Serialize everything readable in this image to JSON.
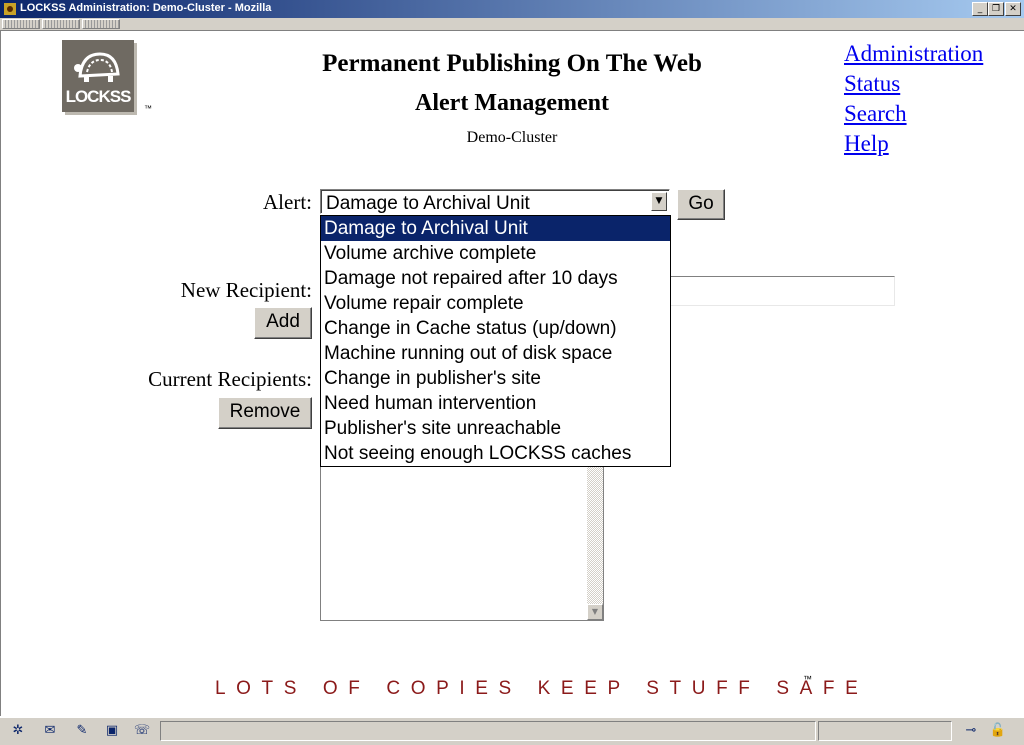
{
  "window": {
    "title": "LOCKSS Administration: Demo-Cluster - Mozilla",
    "minimize_glyph": "_",
    "restore_glyph": "❐",
    "close_glyph": "✕"
  },
  "logo": {
    "text": "LOCKSS",
    "tm": "™"
  },
  "header": {
    "title": "Permanent Publishing On The Web",
    "page_title": "Alert Management",
    "cluster": "Demo-Cluster"
  },
  "nav": {
    "links": [
      "Administration",
      "Status",
      "Search",
      "Help"
    ]
  },
  "form": {
    "alert_label": "Alert:",
    "alert_selected": "Damage to Archival Unit",
    "go_label": "Go",
    "new_recipient_label": "New Recipient:",
    "add_label": "Add",
    "current_recipients_label": "Current Recipients:",
    "remove_label": "Remove"
  },
  "dropdown": {
    "options": [
      "Damage to Archival Unit",
      "Volume archive complete",
      "Damage not repaired after 10 days",
      "Volume repair complete",
      "Change in Cache status (up/down)",
      "Machine running out of disk space",
      "Change in publisher's site",
      "Need human intervention",
      "Publisher's site unreachable",
      "Not seeing enough LOCKSS caches"
    ],
    "selected_index": 0
  },
  "footer": {
    "slogan": "LOTS OF COPIES KEEP STUFF SAFE",
    "tm": "™"
  },
  "statusbar": {
    "icons": [
      "navigator-icon",
      "mail-icon",
      "composer-icon",
      "addressbook-icon",
      "chat-icon"
    ]
  },
  "colors": {
    "link": "#0000ee",
    "selection": "#0a246a",
    "slogan": "#8b1a1a",
    "chrome": "#d4d0c8"
  }
}
